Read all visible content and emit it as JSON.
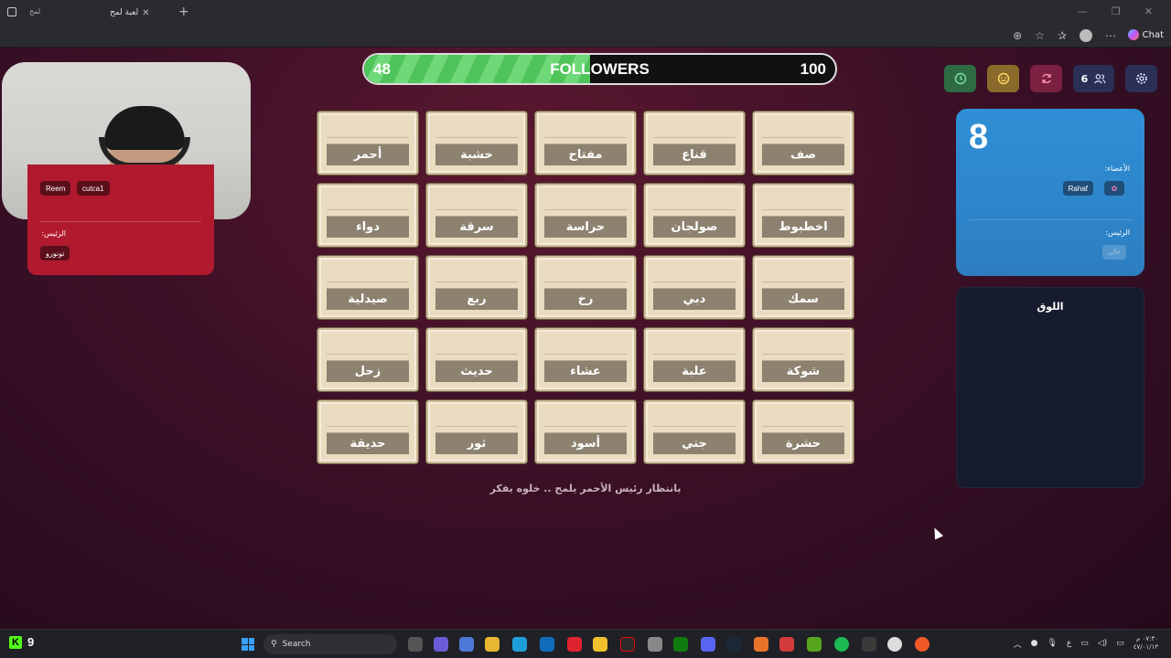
{
  "browser": {
    "tab_title": "لعبة لمح",
    "small_tab": "لمح",
    "chat_label": "Chat"
  },
  "followers": {
    "current": "48",
    "label": "FOLLOWERS",
    "goal": "100",
    "progress_fraction": 0.48,
    "fill_color": "#4fc45a"
  },
  "red_team": {
    "color": "#b11a2e",
    "members": [
      "Reem",
      "cutca1"
    ],
    "leader_label": ":الرئيس",
    "leader": "تونورو"
  },
  "controls": {
    "team_count": "6",
    "icons": [
      "clock-icon",
      "smile-icon",
      "refresh-icon",
      "users-icon",
      "gear-icon"
    ]
  },
  "blue_team": {
    "color": "#2f8fd6",
    "count": "8",
    "members_label": ":الأعضاء",
    "members": [
      "Rahaf"
    ],
    "leader_label": ":الرئيس",
    "leader_placeholder": "خالي"
  },
  "log": {
    "title": "اللوق"
  },
  "cards": [
    "أحمر",
    "خشبة",
    "مفتاح",
    "قناع",
    "صف",
    "دواء",
    "سرقة",
    "حراسة",
    "صولجان",
    "اخطبوط",
    "صيدلية",
    "ربع",
    "رخ",
    "دبي",
    "سمك",
    "زحل",
    "حديث",
    "عشاء",
    "علبة",
    "شوكة",
    "حديقة",
    "ثور",
    "أسود",
    "جني",
    "حشرة"
  ],
  "status_message": "بانتظار رئيس الأحمر يلمح .. خلوه يفكر",
  "taskbar": {
    "kick_count": "9",
    "search_label": "Search",
    "tray_lang": "ع",
    "clock_time": "٠٧:٣٠ م",
    "clock_date": "٤٧/٠١/١٣"
  }
}
